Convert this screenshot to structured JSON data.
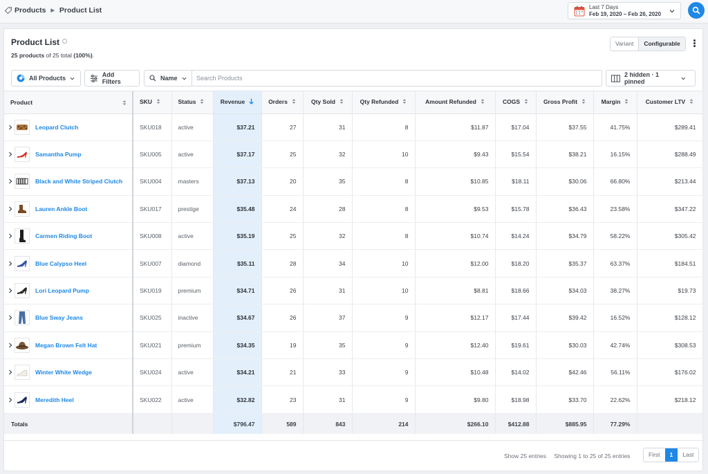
{
  "breadcrumb": {
    "root": "Products",
    "current": "Product List"
  },
  "date_range": {
    "preset": "Last 7 Days",
    "range": "Feb 19, 2020 – Feb 26, 2020"
  },
  "panel": {
    "title": "Product List",
    "count_shown": "25 products",
    "count_mid": " of 25 total ",
    "count_pct": "(100%)",
    "count_end": ".",
    "view_options": [
      "Variant",
      "Configurable"
    ],
    "selected_view": "Configurable"
  },
  "toolbar": {
    "segment": "All Products",
    "add_filters": "Add Filters",
    "search_field": "Name",
    "search_placeholder": "Search Products",
    "columns_status": "2 hidden · 1 pinned"
  },
  "table": {
    "columns": [
      "Product",
      "SKU",
      "Status",
      "Revenue",
      "Orders",
      "Qty Sold",
      "Qty Refunded",
      "Amount Refunded",
      "COGS",
      "Gross Profit",
      "Margin",
      "Customer LTV"
    ],
    "sorted_column": "Revenue",
    "sort_direction": "descending",
    "rows": [
      {
        "product": "Leopard Clutch",
        "thumb": "clutch-icon",
        "sku": "SKU018",
        "status": "active",
        "revenue": "$37.21",
        "orders": "27",
        "qty_sold": "31",
        "qty_refunded": "8",
        "amount_refunded": "$11.87",
        "cogs": "$17.04",
        "gross_profit": "$37.55",
        "margin": "41.75%",
        "ltv": "$289.41"
      },
      {
        "product": "Samantha Pump",
        "thumb": "pump-icon",
        "sku": "SKU005",
        "status": "active",
        "revenue": "$37.17",
        "orders": "25",
        "qty_sold": "32",
        "qty_refunded": "10",
        "amount_refunded": "$9.43",
        "cogs": "$15.54",
        "gross_profit": "$38.21",
        "margin": "16.15%",
        "ltv": "$288.49"
      },
      {
        "product": "Black and White Striped Clutch",
        "thumb": "striped-clutch-icon",
        "sku": "SKU004",
        "status": "masters",
        "revenue": "$37.13",
        "orders": "20",
        "qty_sold": "35",
        "qty_refunded": "8",
        "amount_refunded": "$10.85",
        "cogs": "$18.11",
        "gross_profit": "$30.06",
        "margin": "66.80%",
        "ltv": "$213.44"
      },
      {
        "product": "Lauren Ankle Boot",
        "thumb": "ankle-boot-icon",
        "sku": "SKU017",
        "status": "prestige",
        "revenue": "$35.48",
        "orders": "24",
        "qty_sold": "28",
        "qty_refunded": "8",
        "amount_refunded": "$9.53",
        "cogs": "$15.78",
        "gross_profit": "$36.43",
        "margin": "23.58%",
        "ltv": "$347.22"
      },
      {
        "product": "Carmen Riding Boot",
        "thumb": "riding-boot-icon",
        "sku": "SKU008",
        "status": "active",
        "revenue": "$35.19",
        "orders": "25",
        "qty_sold": "32",
        "qty_refunded": "8",
        "amount_refunded": "$10.74",
        "cogs": "$14.24",
        "gross_profit": "$34.79",
        "margin": "58.22%",
        "ltv": "$305.42"
      },
      {
        "product": "Blue Calypso Heel",
        "thumb": "blue-heel-icon",
        "sku": "SKU007",
        "status": "diamond",
        "revenue": "$35.11",
        "orders": "28",
        "qty_sold": "34",
        "qty_refunded": "10",
        "amount_refunded": "$12.00",
        "cogs": "$18.20",
        "gross_profit": "$35.37",
        "margin": "63.37%",
        "ltv": "$184.51"
      },
      {
        "product": "Lori Leopard Pump",
        "thumb": "leopard-pump-icon",
        "sku": "SKU019",
        "status": "premium",
        "revenue": "$34.71",
        "orders": "26",
        "qty_sold": "31",
        "qty_refunded": "10",
        "amount_refunded": "$8.81",
        "cogs": "$18.66",
        "gross_profit": "$34.03",
        "margin": "38.27%",
        "ltv": "$19.73"
      },
      {
        "product": "Blue Sway Jeans",
        "thumb": "jeans-icon",
        "sku": "SKU025",
        "status": "inactive",
        "revenue": "$34.67",
        "orders": "26",
        "qty_sold": "37",
        "qty_refunded": "9",
        "amount_refunded": "$12.17",
        "cogs": "$17.44",
        "gross_profit": "$39.42",
        "margin": "16.52%",
        "ltv": "$128.12"
      },
      {
        "product": "Megan Brown Felt Hat",
        "thumb": "hat-icon",
        "sku": "SKU021",
        "status": "premium",
        "revenue": "$34.35",
        "orders": "19",
        "qty_sold": "35",
        "qty_refunded": "9",
        "amount_refunded": "$12.40",
        "cogs": "$19.61",
        "gross_profit": "$30.03",
        "margin": "42.74%",
        "ltv": "$308.53"
      },
      {
        "product": "Winter White Wedge",
        "thumb": "wedge-icon",
        "sku": "SKU024",
        "status": "active",
        "revenue": "$34.21",
        "orders": "21",
        "qty_sold": "33",
        "qty_refunded": "9",
        "amount_refunded": "$10.48",
        "cogs": "$14.02",
        "gross_profit": "$42.46",
        "margin": "56.11%",
        "ltv": "$176.02"
      },
      {
        "product": "Meredith Heel",
        "thumb": "navy-heel-icon",
        "sku": "SKU022",
        "status": "active",
        "revenue": "$32.82",
        "orders": "23",
        "qty_sold": "31",
        "qty_refunded": "9",
        "amount_refunded": "$9.80",
        "cogs": "$18.98",
        "gross_profit": "$33.70",
        "margin": "22.62%",
        "ltv": "$218.12"
      }
    ],
    "totals": {
      "label": "Totals",
      "revenue": "$796.47",
      "orders": "589",
      "qty_sold": "843",
      "qty_refunded": "214",
      "amount_refunded": "$266.10",
      "cogs": "$412.88",
      "gross_profit": "$885.95",
      "margin": "77.29%"
    }
  },
  "footer": {
    "show_entries": "Show 25 entries",
    "showing": "Showing 1 to 25 of 25 entries",
    "first": "First",
    "current_page": "1",
    "last": "Last"
  },
  "colors": {
    "accent": "#1e88e5",
    "sorted_column_bg": "#e3f0fb"
  }
}
